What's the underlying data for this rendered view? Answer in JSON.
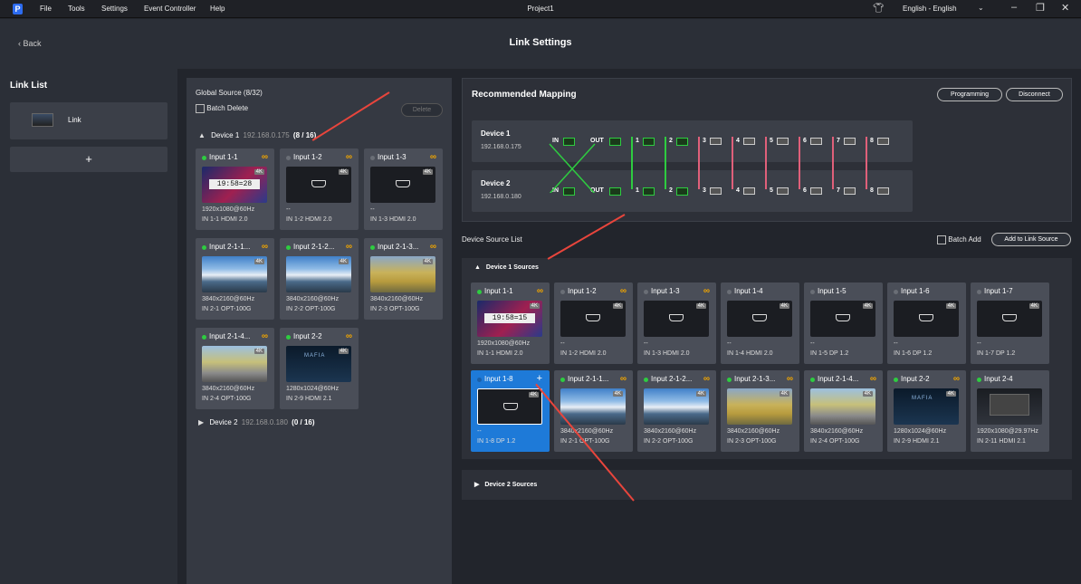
{
  "menubar": {
    "items": [
      "File",
      "Tools",
      "Settings",
      "Event Controller",
      "Help"
    ],
    "window_title": "Project1",
    "language": "English - English"
  },
  "header": {
    "back": "Back",
    "title": "Link Settings"
  },
  "link_list": {
    "title": "Link List",
    "items": [
      {
        "label": "Link"
      }
    ],
    "add_label": "+"
  },
  "global_source": {
    "title": "Global Source (8/32)",
    "batch_delete": "Batch Delete",
    "delete": "Delete",
    "devices": [
      {
        "name": "Device 1",
        "ip": "192.168.0.175",
        "count": "(8 / 16)",
        "expanded": true,
        "cards": [
          {
            "title": "Input 1-1",
            "status": "green",
            "resolution": "1920x1080@60Hz",
            "port": "IN 1-1 HDMI 2.0",
            "thumb": "clock",
            "clock": "19:58=28",
            "linked": true
          },
          {
            "title": "Input 1-2",
            "status": "gray",
            "resolution": "--",
            "port": "IN 1-2 HDMI 2.0",
            "thumb": "hdmi",
            "linked": true
          },
          {
            "title": "Input 1-3",
            "status": "gray",
            "resolution": "--",
            "port": "IN 1-3 HDMI 2.0",
            "thumb": "hdmi",
            "linked": true
          },
          {
            "title": "Input 2-1-1...",
            "status": "green",
            "resolution": "3840x2160@60Hz",
            "port": "IN 2-1 OPT-100G",
            "thumb": "mtn",
            "linked": true
          },
          {
            "title": "Input 2-1-2...",
            "status": "green",
            "resolution": "3840x2160@60Hz",
            "port": "IN 2-2 OPT-100G",
            "thumb": "mtn",
            "linked": true
          },
          {
            "title": "Input 2-1-3...",
            "status": "green",
            "resolution": "3840x2160@60Hz",
            "port": "IN 2-3 OPT-100G",
            "thumb": "field",
            "linked": true
          },
          {
            "title": "Input 2-1-4...",
            "status": "green",
            "resolution": "3840x2160@60Hz",
            "port": "IN 2-4 OPT-100G",
            "thumb": "road",
            "linked": true
          },
          {
            "title": "Input 2-2",
            "status": "green",
            "resolution": "1280x1024@60Hz",
            "port": "IN 2-9 HDMI 2.1",
            "thumb": "mafia",
            "linked": true
          }
        ]
      },
      {
        "name": "Device 2",
        "ip": "192.168.0.180",
        "count": "(0 / 16)",
        "expanded": false,
        "cards": []
      }
    ]
  },
  "recommended_mapping": {
    "title": "Recommended Mapping",
    "programming": "Programming",
    "disconnect": "Disconnect",
    "devices": [
      {
        "name": "Device 1",
        "ip": "192.168.0.175"
      },
      {
        "name": "Device 2",
        "ip": "192.168.0.180"
      }
    ],
    "in_label": "IN",
    "out_label": "OUT",
    "ports": [
      "1",
      "2",
      "3",
      "4",
      "5",
      "6",
      "7",
      "8"
    ]
  },
  "device_source_list": {
    "title": "Device Source List",
    "batch_add": "Batch Add",
    "add_to_link_source": "Add to Link Source",
    "groups": [
      {
        "name": "Device 1 Sources",
        "expanded": true,
        "cards": [
          {
            "title": "Input 1-1",
            "status": "green",
            "resolution": "1920x1080@60Hz",
            "port": "IN 1-1 HDMI 2.0",
            "thumb": "clock",
            "clock": "19:58=15",
            "linked": true
          },
          {
            "title": "Input 1-2",
            "status": "gray",
            "resolution": "--",
            "port": "IN 1-2 HDMI 2.0",
            "thumb": "hdmi",
            "linked": true
          },
          {
            "title": "Input 1-3",
            "status": "gray",
            "resolution": "--",
            "port": "IN 1-3 HDMI 2.0",
            "thumb": "hdmi",
            "linked": true
          },
          {
            "title": "Input 1-4",
            "status": "gray",
            "resolution": "--",
            "port": "IN 1-4 HDMI 2.0",
            "thumb": "hdmi",
            "linked": false
          },
          {
            "title": "Input 1-5",
            "status": "gray",
            "resolution": "--",
            "port": "IN 1-5 DP 1.2",
            "thumb": "hdmi",
            "linked": false
          },
          {
            "title": "Input 1-6",
            "status": "gray",
            "resolution": "--",
            "port": "IN 1-6 DP 1.2",
            "thumb": "hdmi",
            "linked": false
          },
          {
            "title": "Input 1-7",
            "status": "gray",
            "resolution": "--",
            "port": "IN 1-7 DP 1.2",
            "thumb": "hdmi",
            "linked": false
          },
          {
            "title": "Input 1-8",
            "status": "blue",
            "resolution": "--",
            "port": "IN 1-8 DP 1.2",
            "thumb": "hdmi",
            "linked": false,
            "selected": true
          },
          {
            "title": "Input 2-1-1...",
            "status": "green",
            "resolution": "3840x2160@60Hz",
            "port": "IN 2-1 OPT-100G",
            "thumb": "mtn",
            "linked": true
          },
          {
            "title": "Input 2-1-2...",
            "status": "green",
            "resolution": "3840x2160@60Hz",
            "port": "IN 2-2 OPT-100G",
            "thumb": "mtn",
            "linked": true
          },
          {
            "title": "Input 2-1-3...",
            "status": "green",
            "resolution": "3840x2160@60Hz",
            "port": "IN 2-3 OPT-100G",
            "thumb": "field",
            "linked": true
          },
          {
            "title": "Input 2-1-4...",
            "status": "green",
            "resolution": "3840x2160@60Hz",
            "port": "IN 2-4 OPT-100G",
            "thumb": "road",
            "linked": true
          },
          {
            "title": "Input 2-2",
            "status": "green",
            "resolution": "1280x1024@60Hz",
            "port": "IN 2-9 HDMI 2.1",
            "thumb": "mafia",
            "linked": true
          },
          {
            "title": "Input 2-4",
            "status": "green",
            "resolution": "1920x1080@29.97Hz",
            "port": "IN 2-11 HDMI 2.1",
            "thumb": "desk",
            "linked": false
          }
        ]
      },
      {
        "name": "Device 2 Sources",
        "expanded": false,
        "cards": []
      }
    ]
  },
  "badge_4k": "4K",
  "mafia_text": "MAFIA",
  "colors": {
    "status_green": "#2ecc40",
    "status_gray": "#6a6e76",
    "link_orange": "#f0a500",
    "selected_blue": "#1e7ad8",
    "annotation_red": "#e8453c"
  }
}
